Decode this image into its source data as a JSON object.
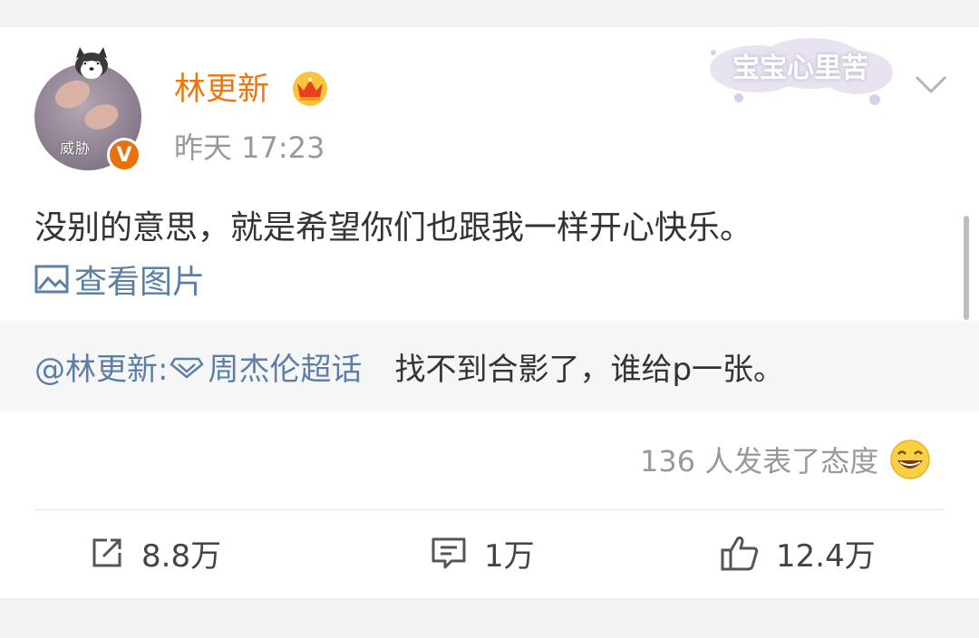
{
  "post": {
    "author": {
      "name": "林更新",
      "avatar_tag": "威胁",
      "verified_badge": "V",
      "crown_icon": "crown-icon"
    },
    "time": "昨天 17:23",
    "watermark": "宝宝心里苦",
    "text": "没别的意思，就是希望你们也跟我一样开心快乐。",
    "view_images_label": "查看图片",
    "repost": {
      "mention": "@林更新:",
      "topic": "周杰伦超话",
      "text": "找不到合影了，谁给p一张。"
    },
    "reactions_text": "136 人发表了态度",
    "actions": {
      "share_count": "8.8万",
      "comment_count": "1万",
      "like_count": "12.4万"
    }
  },
  "colors": {
    "username": "#f0750f",
    "link": "#5b7fa6",
    "muted": "#999999",
    "body": "#333333"
  }
}
